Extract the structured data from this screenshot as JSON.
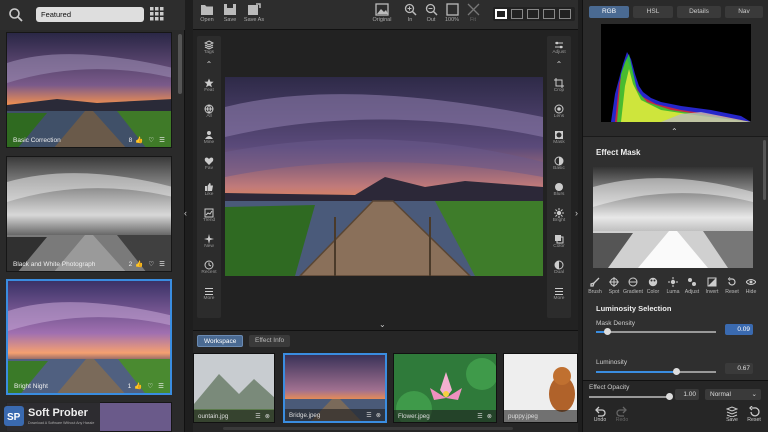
{
  "search": {
    "value": "Featured"
  },
  "presets": [
    {
      "name": "Basic Correction",
      "count": "8"
    },
    {
      "name": "Black and White Photograph",
      "count": "2"
    },
    {
      "name": "Bright Night",
      "count": "1"
    }
  ],
  "brand": {
    "name": "Soft Prober",
    "tagline": "Download A Software Without Any Hassle"
  },
  "toolbar": {
    "open": "Open",
    "save": "Save",
    "save_as": "Save As",
    "original": "Original",
    "zoom_in": "In",
    "zoom_out": "Out",
    "zoom_100": "100%",
    "fit": "Fit"
  },
  "left_tools": [
    "Tags",
    "Feat",
    "All",
    "Mine",
    "Fav",
    "Like",
    "Trend",
    "New",
    "Recent",
    "More"
  ],
  "right_tools": [
    "Adjust",
    "Crop",
    "Lens",
    "Mask",
    "Basic",
    "Blurs",
    "Bright",
    "Color",
    "Dual",
    "More"
  ],
  "strip": {
    "tabs": [
      "Workspace",
      "Effect Info"
    ],
    "files": [
      "ountain.jpg",
      "Bridge.jpeg",
      "Flower.jpeg",
      "puppy.jpeg"
    ]
  },
  "right_panel": {
    "tabs": [
      "RGB",
      "HSL",
      "Details",
      "Nav"
    ],
    "effect_mask_title": "Effect Mask",
    "mask_tools": [
      "Brush",
      "Spot",
      "Gradient",
      "Color",
      "Luma",
      "Adjust",
      "Invert",
      "Reset",
      "Hide"
    ],
    "luminosity_title": "Luminosity Selection",
    "mask_density_label": "Mask Density",
    "mask_density": 0.09,
    "mask_density_text": "0.09",
    "luminosity_label": "Luminosity",
    "luminosity": 0.67,
    "luminosity_text": "0.67",
    "effect_opacity_label": "Effect Opacity",
    "effect_opacity": 1.0,
    "effect_opacity_text": "1.00",
    "blend_mode": "Normal",
    "footer": [
      "Undo",
      "Redo",
      "Save",
      "Reset"
    ]
  },
  "colors": {
    "accent": "#3a8de0",
    "panel": "#2a2a2a",
    "sky_orange": "#f08a4a",
    "sky_purple": "#5a4a8a"
  }
}
